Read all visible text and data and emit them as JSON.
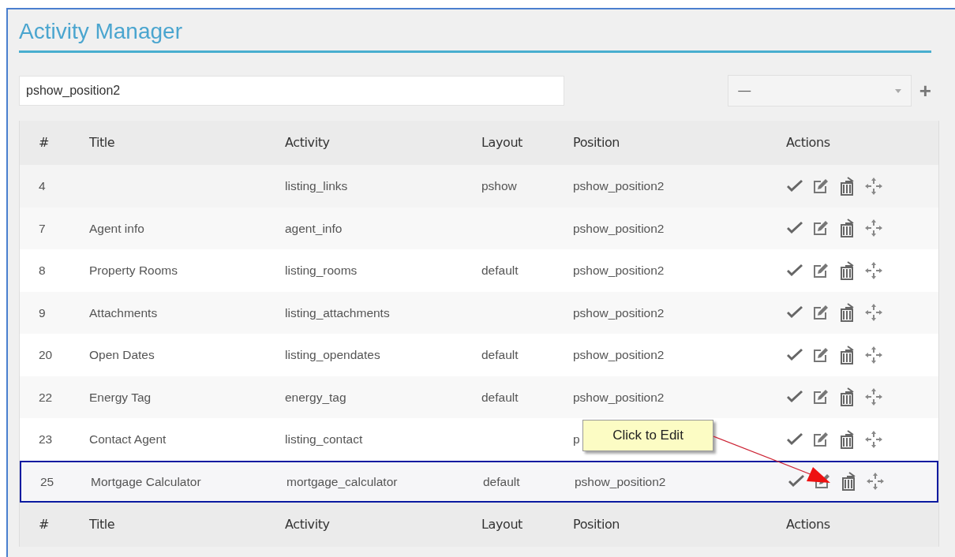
{
  "title": "Activity Manager",
  "filter": {
    "value": "pshow_position2"
  },
  "select": {
    "value": "—"
  },
  "add_button": "+",
  "columns": [
    "#",
    "Title",
    "Activity",
    "Layout",
    "Position",
    "Actions"
  ],
  "rows": [
    {
      "id": "4",
      "title": "",
      "activity": "listing_links",
      "layout": "pshow",
      "position": "pshow_position2",
      "selected": false
    },
    {
      "id": "7",
      "title": "Agent info",
      "activity": "agent_info",
      "layout": "",
      "position": "pshow_position2",
      "selected": false
    },
    {
      "id": "8",
      "title": "Property Rooms",
      "activity": "listing_rooms",
      "layout": "default",
      "position": "pshow_position2",
      "selected": false
    },
    {
      "id": "9",
      "title": "Attachments",
      "activity": "listing_attachments",
      "layout": "",
      "position": "pshow_position2",
      "selected": false
    },
    {
      "id": "20",
      "title": "Open Dates",
      "activity": "listing_opendates",
      "layout": "default",
      "position": "pshow_position2",
      "selected": false
    },
    {
      "id": "22",
      "title": "Energy Tag",
      "activity": "energy_tag",
      "layout": "default",
      "position": "pshow_position2",
      "selected": false
    },
    {
      "id": "23",
      "title": "Contact Agent",
      "activity": "listing_contact",
      "layout": "",
      "position": "p",
      "selected": false
    },
    {
      "id": "25",
      "title": "Mortgage Calculator",
      "activity": "mortgage_calculator",
      "layout": "default",
      "position": "pshow_position2",
      "selected": true
    }
  ],
  "footer_columns": [
    "#",
    "Title",
    "Activity",
    "Layout",
    "Position",
    "Actions"
  ],
  "callout": {
    "text": "Click to Edit"
  }
}
